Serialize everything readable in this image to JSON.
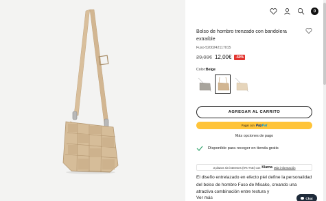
{
  "header": {
    "cart_count": "0",
    "icons": [
      "heart-icon",
      "user-icon",
      "search-icon",
      "cart-badge"
    ]
  },
  "product": {
    "title": "Bolso de hombro trenzado con bandolera extraíble",
    "sku": "Fuso-5200242117015",
    "old_price": "29,99€",
    "new_price": "12,00€",
    "discount": "-60%",
    "color_label": "Color:",
    "color_value": "Beige",
    "colors": {
      "accent_beige": "#c9b08e",
      "discount_red": "#e2332e",
      "paypal_yellow": "#ffc439",
      "check_green": "#2fa36b"
    }
  },
  "actions": {
    "add_to_cart": "AGREGAR AL CARRITO",
    "paypal_prefix": "Pagar con",
    "paypal_brand_a": "Pay",
    "paypal_brand_b": "Pal",
    "more_payment": "Más opciones de pago"
  },
  "pickup": {
    "text": "Disponible para recoger en tienda gratis"
  },
  "klarna": {
    "text": "3 plazos sin intereses (0% TAE) con",
    "brand": "Klarna",
    "info": "Más información"
  },
  "description": {
    "text": "El diseño entrelazado en efecto piel define la personalidad del bolso de hombro Fuso de Misako, creando una atractiva combinación entre textura y",
    "more": "Ver más"
  },
  "chat": {
    "label": "Chat"
  }
}
